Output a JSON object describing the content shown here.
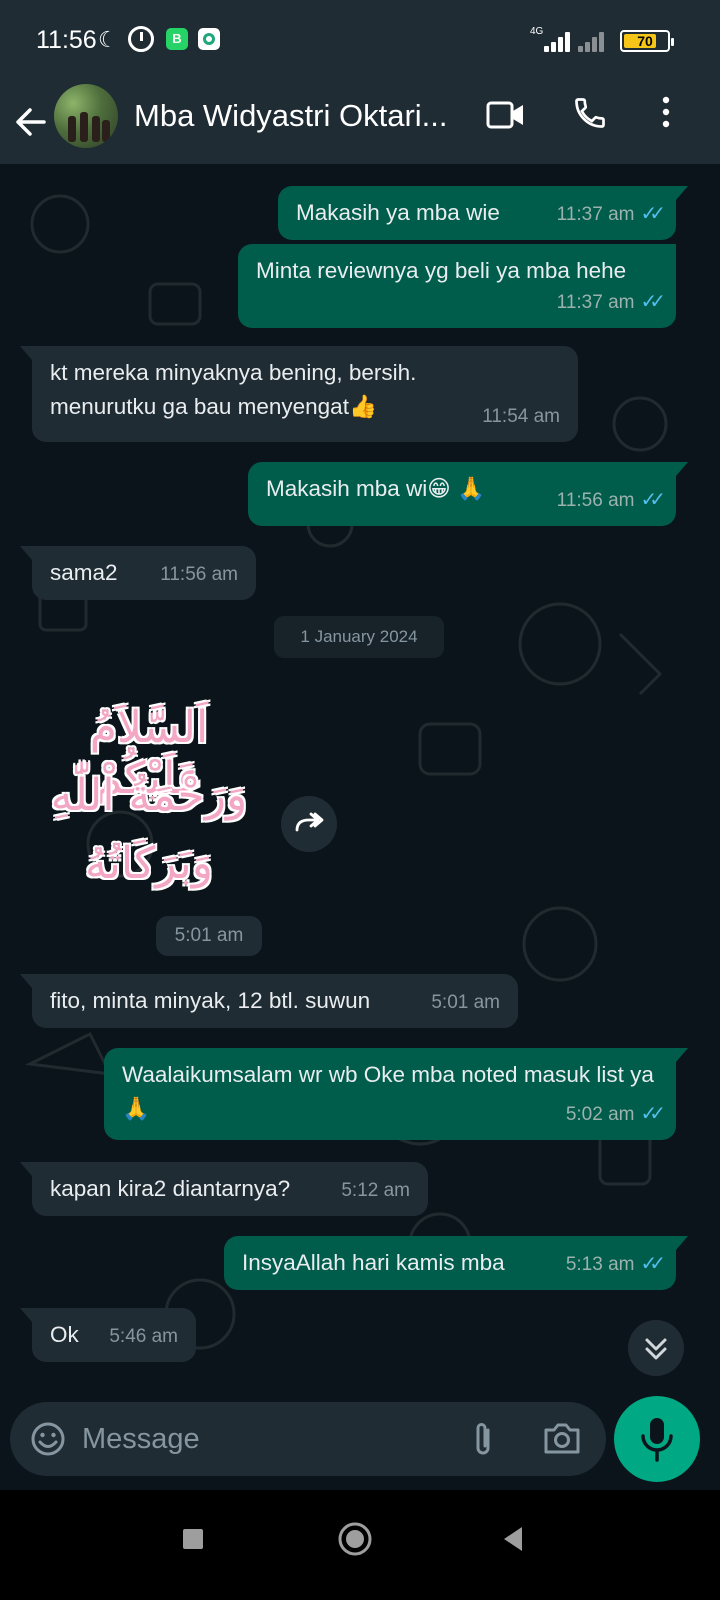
{
  "status_bar": {
    "time": "11:56",
    "network_label": "4G",
    "battery_level": "70",
    "battery_percent": 70
  },
  "header": {
    "contact_name": "Mba Widyastri Oktari...",
    "icons": [
      "back-arrow-icon",
      "video-call-icon",
      "voice-call-icon",
      "more-options-icon"
    ]
  },
  "messages": [
    {
      "dir": "out",
      "text": "Makasih ya mba wie",
      "time": "11:37 am",
      "read": true
    },
    {
      "dir": "out",
      "text": "Minta reviewnya yg beli ya mba hehe",
      "time": "11:37 am",
      "read": true
    },
    {
      "dir": "in",
      "text": "kt mereka minyaknya bening, bersih. menurutku ga bau menyengat👍",
      "time": "11:54 am"
    },
    {
      "dir": "out",
      "text": "Makasih mba wi😁 🙏",
      "time": "11:56 am",
      "read": true
    },
    {
      "dir": "in",
      "text": "sama2",
      "time": "11:56 am"
    },
    {
      "dir": "in",
      "text": "fito, minta minyak, 12 btl. suwun",
      "time": "5:01 am"
    },
    {
      "dir": "out",
      "text": "Waalaikumsalam wr wb Oke mba noted masuk list ya🙏",
      "time": "5:02 am",
      "read": true
    },
    {
      "dir": "in",
      "text": "kapan kira2 diantarnya?",
      "time": "5:12 am"
    },
    {
      "dir": "out",
      "text": "InsyaAllah hari kamis mba",
      "time": "5:13 am",
      "read": true
    },
    {
      "dir": "in",
      "text": "Ok",
      "time": "5:46 am"
    }
  ],
  "date_separator": "1 January 2024",
  "sticker": {
    "lines": [
      "اَلسَّلاَمُ عَلَيْكُمْ",
      "وَرَحْمَةُ اللّٰهِ",
      "وَبَرَكَاتُهُ"
    ],
    "time": "5:01 am"
  },
  "composer": {
    "placeholder": "Message"
  },
  "colors": {
    "outgoing_bubble": "#005c4b",
    "incoming_bubble": "#202c33",
    "read_ticks": "#53bdeb",
    "mic_button": "#00a884"
  }
}
